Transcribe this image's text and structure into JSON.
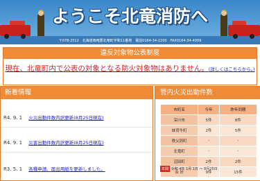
{
  "header": {
    "title": "ようこそ北竜消防へ",
    "address": "〒078-2512　北海道雨竜郡北竜町字和11番地　電話0164-34-2200　FAX0164-34-4009"
  },
  "notice": {
    "heading": "違反対象物公表制度",
    "message_main": "現在、北竜町内で公表の対象となる防火対象物はありません。",
    "message_link": "(詳しくはこちらから。)"
  },
  "news": {
    "heading": "新着情報",
    "items": [
      {
        "date": "R4. 9. 1",
        "text": "火災出動件数内訳更新(8月25日現在)"
      },
      {
        "date": "R4. 9. 1",
        "text": "災害出動件数内訳更新(8月25日現在)"
      },
      {
        "date": "R3. 5. 1",
        "text": "各種申請、届出用紙を更新しました。"
      }
    ]
  },
  "fire_stats": {
    "heading": "管内火災出動件数",
    "columns": [
      "市町名",
      "今年",
      "昨年同期"
    ],
    "rows": [
      [
        "深川市",
        "5件",
        "8件"
      ],
      [
        "妹背牛町",
        "2件",
        "5件"
      ],
      [
        "秩父別町",
        "-",
        "-"
      ],
      [
        "北竜町",
        "-",
        "-"
      ],
      [
        "沼田町",
        "2件",
        "2件"
      ],
      [
        "合 計",
        "9件",
        "15件"
      ]
    ],
    "footer_tag": "年間",
    "footer_text": "令和 4年 1月 1日 ～ 8月25日"
  }
}
